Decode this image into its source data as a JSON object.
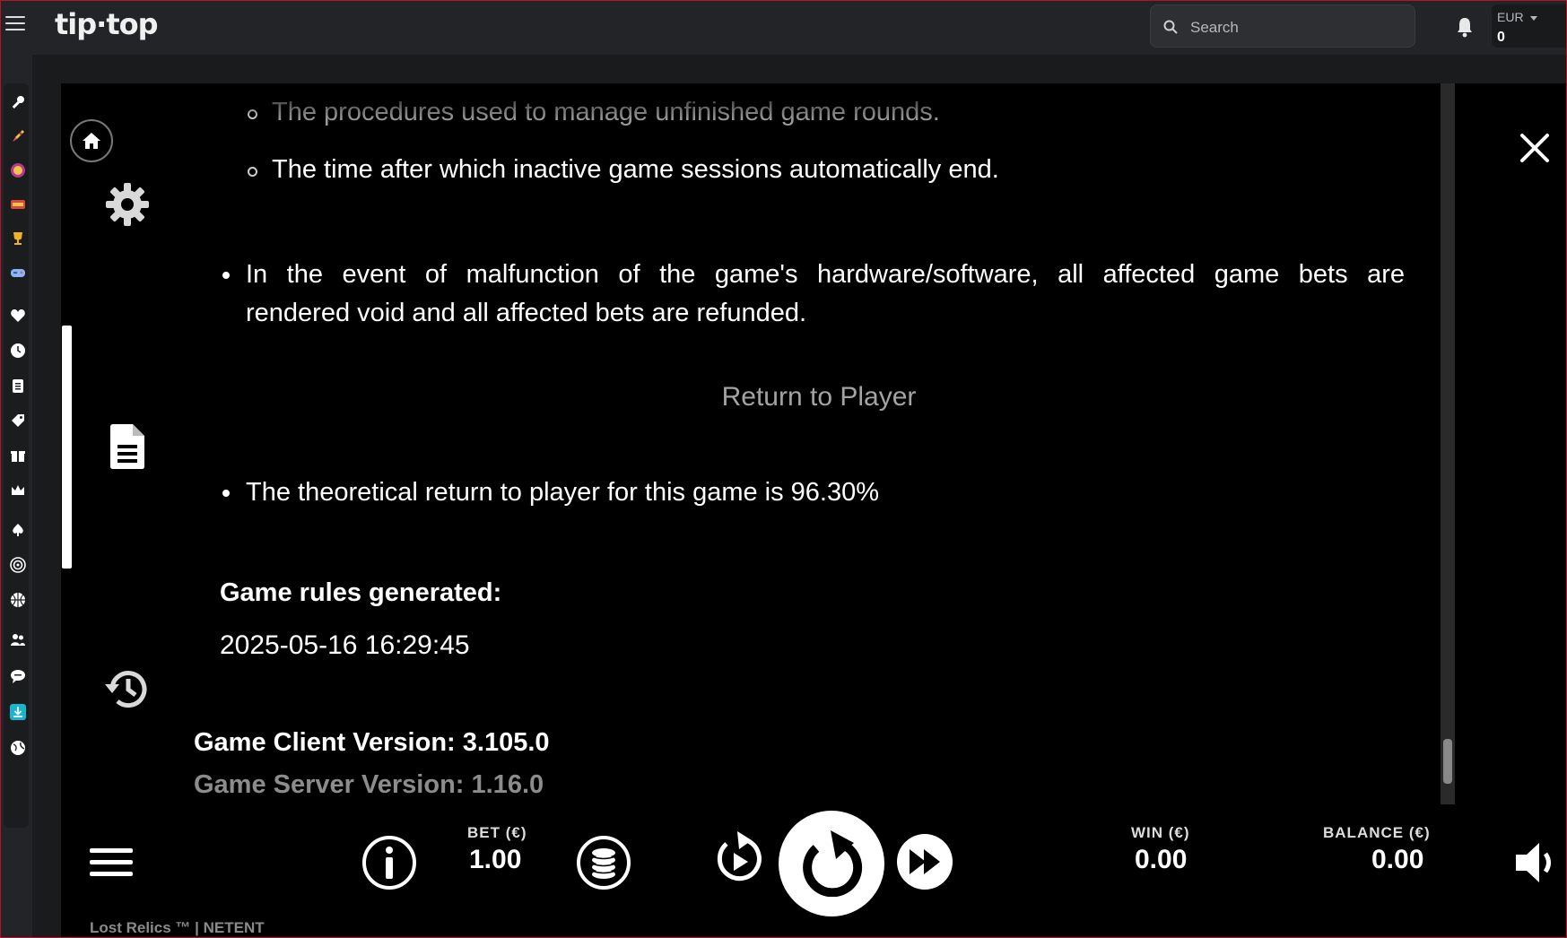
{
  "header": {
    "logo_text": "tip·top",
    "search_placeholder": "Search",
    "currency": "EUR",
    "balance": "0"
  },
  "left_nav": {
    "icons": [
      "wrench-icon",
      "rocket-icon",
      "badge-icon",
      "store-icon",
      "trophy-icon",
      "gamepad-icon",
      "heart-icon",
      "clock-icon",
      "clipboard-icon",
      "tag-icon",
      "gift-icon",
      "crown-icon",
      "spade-icon",
      "target-icon",
      "basketball-icon",
      "users-icon",
      "chat-icon",
      "download-icon",
      "globe-icon"
    ]
  },
  "game_menu": {
    "icons": [
      "home-icon",
      "settings-icon",
      "document-icon",
      "history-icon"
    ]
  },
  "rules": {
    "sub_items": [
      "The procedures used to manage unfinished game rounds.",
      "The time after which inactive game sessions automatically end."
    ],
    "malfunction_line1": "In the event of malfunction of the game's hardware/software, all affected game bets are",
    "malfunction_line2": "rendered void and all affected bets are refunded.",
    "rtp_title": "Return to Player",
    "rtp_text": "The theoretical return to player for this game is 96.30%",
    "generated_label": "Game rules generated:",
    "generated_value": "2025-05-16 16:29:45",
    "client_version": "Game Client Version: 3.105.0",
    "server_version": "Game Server Version: 1.16.0"
  },
  "controls": {
    "bet_label": "BET (€)",
    "bet_value": "1.00",
    "win_label": "WIN (€)",
    "win_value": "0.00",
    "balance_label": "BALANCE (€)",
    "balance_value": "0.00"
  },
  "footer": {
    "text": "Lost Relics ™  |  NETENT"
  }
}
